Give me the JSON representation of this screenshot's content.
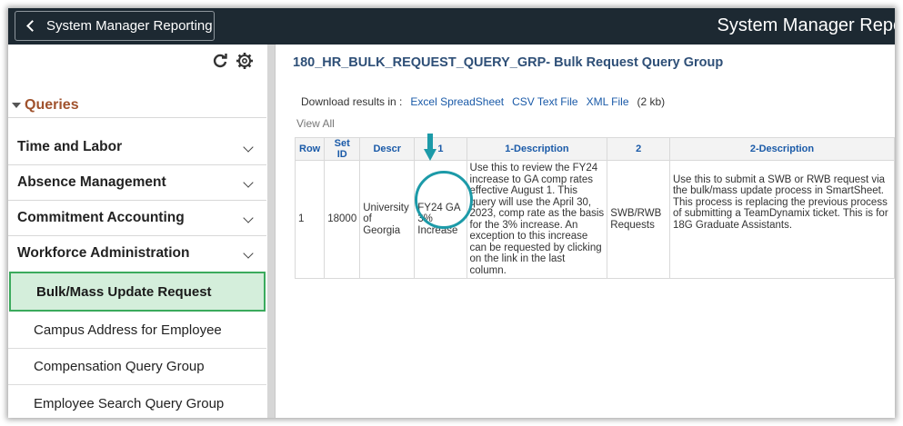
{
  "header": {
    "back_label": "System Manager Reporting",
    "app_title": "System Manager Reporting"
  },
  "sidebar": {
    "section_label": "Queries",
    "categories": [
      {
        "label": "Time and Labor"
      },
      {
        "label": "Absence Management"
      },
      {
        "label": "Commitment Accounting"
      },
      {
        "label": "Workforce Administration"
      }
    ],
    "items": [
      {
        "label": "Bulk/Mass Update Request",
        "selected": true
      },
      {
        "label": "Campus Address for Employee"
      },
      {
        "label": "Compensation Query Group"
      },
      {
        "label": "Employee Search Query Group"
      }
    ]
  },
  "main": {
    "title": "180_HR_BULK_REQUEST_QUERY_GRP- Bulk Request Query Group",
    "download_label": "Download results in :",
    "download_links": [
      "Excel SpreadSheet",
      "CSV Text File",
      "XML File"
    ],
    "file_size": "(2 kb)",
    "view_all": "View All",
    "columns": [
      "Row",
      "Set ID",
      "Descr",
      "1",
      "1-Description",
      "2",
      "2-Description"
    ],
    "rows": [
      {
        "row": "1",
        "set_id": "18000",
        "descr": "University of Georgia",
        "c1": "FY24 GA 3% Increase",
        "d1": "Use this to review the FY24 increase to GA comp rates effective August 1. This query will use the April 30, 2023, comp rate as the basis for the 3% increase. An exception to this increase can be requested by clicking on the link in the last column.",
        "c2": "SWB/RWB Requests",
        "d2": "Use this to submit a SWB or RWB request via the bulk/mass update process in SmartSheet. This process is replacing the previous process of submitting a TeamDynamix ticket. This is for 18G Graduate Assistants."
      }
    ]
  },
  "colors": {
    "header_bg": "#1d2932",
    "accent_link": "#1a5aa8",
    "section_color": "#a0522d",
    "selected_bg": "#d4eedb",
    "selected_border": "#3aaa5c",
    "highlight": "#1c9aa8"
  }
}
